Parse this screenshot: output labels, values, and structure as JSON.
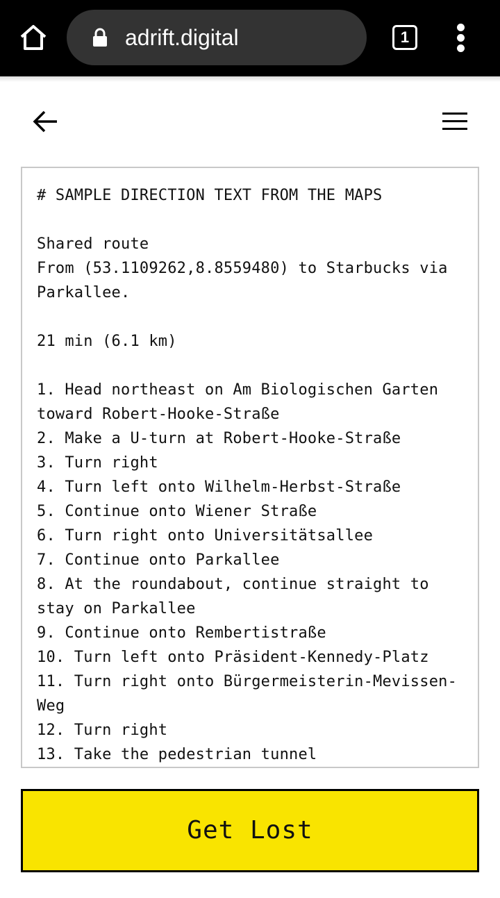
{
  "browser": {
    "url": "adrift.digital",
    "tab_count": "1",
    "icons": [
      "home-icon",
      "lock-icon",
      "tabs-icon",
      "overflow-menu-icon"
    ]
  },
  "header": {
    "icons": [
      "back-arrow-icon",
      "hamburger-menu-icon"
    ]
  },
  "directions": {
    "lines": [
      "# SAMPLE DIRECTION TEXT FROM THE MAPS",
      "",
      "Shared route",
      "From (53.1109262,8.8559480) to Starbucks via",
      "Parkallee.",
      "",
      "21 min (6.1 km)",
      "",
      "1. Head northeast on Am Biologischen Garten",
      "toward Robert-Hooke-Straße",
      "2. Make a U-turn at Robert-Hooke-Straße",
      "3. Turn right",
      "4. Turn left onto Wilhelm-Herbst-Straße",
      "5. Continue onto Wiener Straße",
      "6. Turn right onto Universitätsallee",
      "7. Continue onto Parkallee",
      "8. At the roundabout, continue straight to",
      "stay on Parkallee",
      "9. Continue onto Rembertistraße",
      "10. Turn left onto Präsident-Kennedy-Platz",
      "11. Turn right onto Bürgermeisterin-Mevissen-",
      "Weg",
      "12. Turn right",
      "13. Take the pedestrian tunnel"
    ]
  },
  "action": {
    "label": "Get Lost",
    "color": "#f9e400"
  }
}
